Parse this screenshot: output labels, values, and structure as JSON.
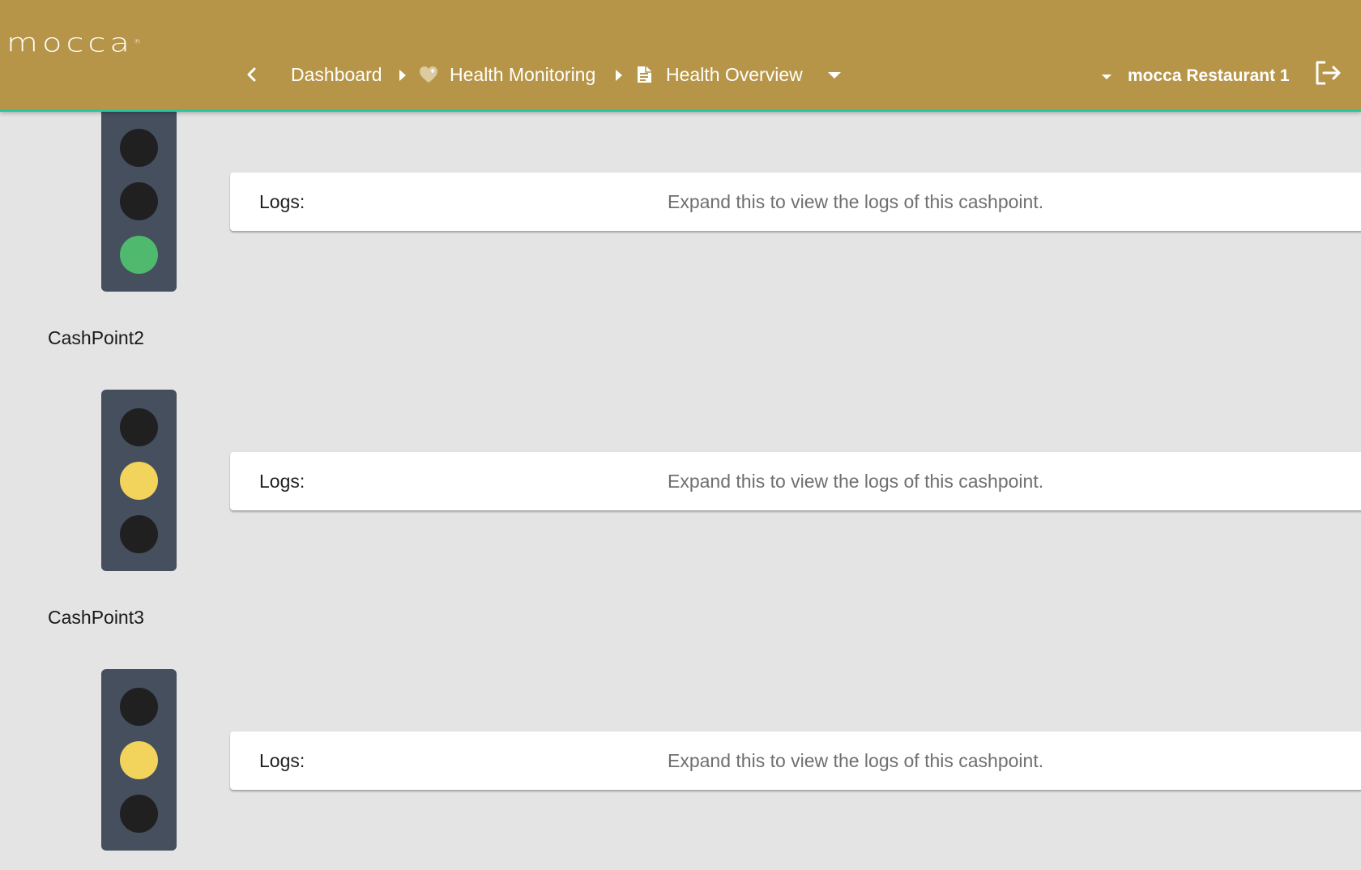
{
  "header": {
    "logo_text": "mocca",
    "logo_mark": "®",
    "back_icon": "chevron-left-icon",
    "breadcrumb": [
      {
        "label": "Dashboard",
        "icon": null
      },
      {
        "label": "Health Monitoring",
        "icon": "heart-icon"
      },
      {
        "label": "Health Overview",
        "icon": "document-icon"
      }
    ],
    "breadcrumb_separator_icon": "caret-right-icon",
    "breadcrumb_dropdown_icon": "caret-down-icon",
    "restaurant_selector": {
      "label": "mocca Restaurant 1",
      "icon": "caret-down-icon"
    },
    "logout_icon": "logout-icon"
  },
  "colors": {
    "header_bg": "#b79548",
    "header_accent": "#26c79a",
    "light_housing": "#454f5e",
    "lamp_off": "#202020",
    "lamp_green": "#4fb96e",
    "lamp_yellow": "#f2d35b"
  },
  "cashpoints": [
    {
      "name": "",
      "status": "green",
      "logs_label": "Logs:",
      "logs_hint": "Expand this to view the logs of this cashpoint."
    },
    {
      "name": "CashPoint2",
      "status": "yellow",
      "logs_label": "Logs:",
      "logs_hint": "Expand this to view the logs of this cashpoint."
    },
    {
      "name": "CashPoint3",
      "status": "yellow",
      "logs_label": "Logs:",
      "logs_hint": "Expand this to view the logs of this cashpoint."
    }
  ]
}
